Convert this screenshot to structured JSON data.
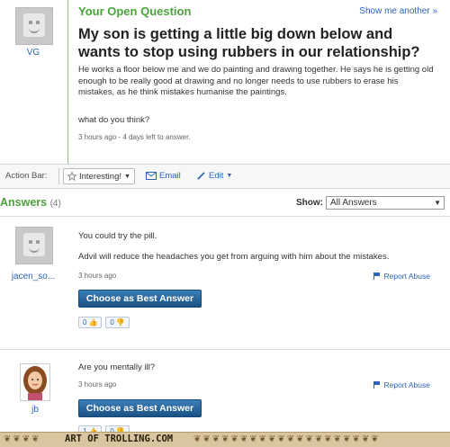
{
  "question": {
    "header": "Your Open Question",
    "show_another": "Show me another »",
    "asker": "VG",
    "title": "My son is getting a little big down below and wants to stop using rubbers in our relationship?",
    "body": "He works a floor below me and we do painting and drawing together. He says he is getting old enough to be really good at drawing and no longer needs to use rubbers to erase his mistakes, as he think mistakes humanise the paintings.",
    "ask": "what do you think?",
    "meta": "3 hours ago - 4 days left to answer."
  },
  "action_bar": {
    "label": "Action Bar:",
    "interesting": "Interesting!",
    "email": "Email",
    "edit": "Edit"
  },
  "answers": {
    "header": "Answers",
    "count": "(4)",
    "show_label": "Show:",
    "show_value": "All Answers",
    "items": [
      {
        "user": "jacen_so...",
        "line1": "You could try the pill.",
        "line2": "Advil will reduce the headaches you get from arguing with him about the mistakes.",
        "meta": "3 hours ago",
        "report": "Report Abuse",
        "best": "Choose as Best Answer",
        "up": "0",
        "down": "0"
      },
      {
        "user": "jb",
        "line1": "Are you mentally ill?",
        "meta": "3 hours ago",
        "report": "Report Abuse",
        "best": "Choose as Best Answer",
        "up": "1",
        "down": "0"
      }
    ]
  },
  "footer": {
    "text": "ART OF TROLLING.COM"
  },
  "colors": {
    "accent_green": "#4aa33a",
    "link_blue": "#2b63b8",
    "button_blue": "#1d5d94"
  }
}
